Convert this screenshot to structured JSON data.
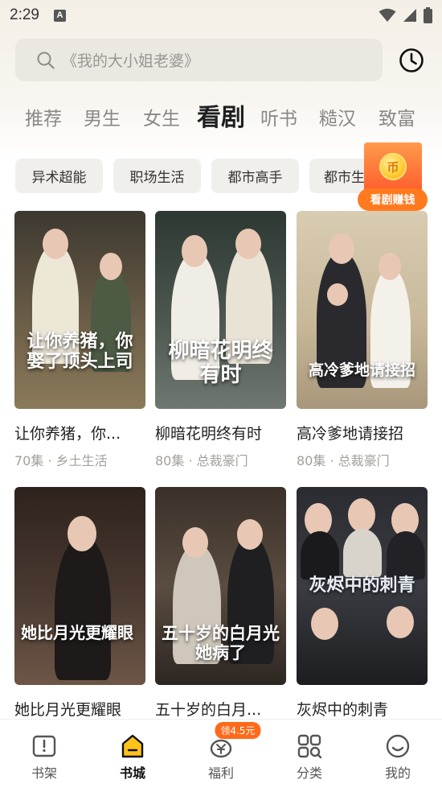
{
  "status_bar": {
    "time": "2:29",
    "notification_icon": "A"
  },
  "search": {
    "placeholder": "《我的大小姐老婆》"
  },
  "tabs": [
    {
      "label": "推荐",
      "active": false
    },
    {
      "label": "男生",
      "active": false
    },
    {
      "label": "女生",
      "active": false
    },
    {
      "label": "看剧",
      "active": true
    },
    {
      "label": "听书",
      "active": false
    },
    {
      "label": "糙汉",
      "active": false
    },
    {
      "label": "致富",
      "active": false
    }
  ],
  "chips": [
    "异术超能",
    "职场生活",
    "都市高手",
    "都市生活"
  ],
  "reward": {
    "label": "看剧赚钱",
    "coin_text": "币"
  },
  "dramas": [
    {
      "title": "让你养猪，你...",
      "meta": "70集 · 乡土生活",
      "poster_text": "让你养猪，你娶了顶头上司",
      "colors": [
        "#5b4e3a",
        "#8d7b5d"
      ]
    },
    {
      "title": "柳暗花明终有时",
      "meta": "80集 · 总裁豪门",
      "poster_text": "柳暗花明终有时",
      "colors": [
        "#3b4641",
        "#6c756d"
      ]
    },
    {
      "title": "高冷爹地请接招",
      "meta": "80集 · 总裁豪门",
      "poster_text": "高冷爹地请接招",
      "colors": [
        "#cbbba0",
        "#e7dbc3"
      ]
    },
    {
      "title": "她比月光更耀眼",
      "meta": "",
      "poster_text": "她比月光更耀眼",
      "colors": [
        "#3d2e27",
        "#6e5647"
      ]
    },
    {
      "title": "五十岁的白月...",
      "meta": "",
      "poster_text": "五十岁的白月光她病了",
      "colors": [
        "#2e2925",
        "#6a5b4c"
      ]
    },
    {
      "title": "灰烬中的刺青",
      "meta": "",
      "poster_text": "灰烬中的刺青",
      "colors": [
        "#25282d",
        "#4c5058"
      ]
    }
  ],
  "bottom_nav": [
    {
      "label": "书架",
      "icon": "bookshelf-icon",
      "active": false
    },
    {
      "label": "书城",
      "icon": "bookstore-icon",
      "active": true
    },
    {
      "label": "福利",
      "icon": "welfare-icon",
      "active": false,
      "badge": "领4.5元"
    },
    {
      "label": "分类",
      "icon": "category-icon",
      "active": false
    },
    {
      "label": "我的",
      "icon": "profile-icon",
      "active": false
    }
  ],
  "colors": {
    "accent": "#ff7a1e",
    "tab_active": "#1f1f1f",
    "tab_inactive": "#8a8784",
    "nav_active_icon": "#ffb800"
  }
}
